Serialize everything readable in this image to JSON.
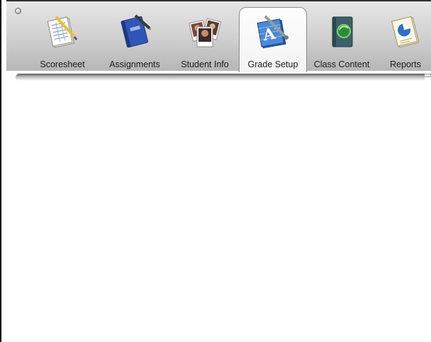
{
  "toolbar": {
    "tabs": [
      {
        "label": "Scoresheet",
        "icon": "scoresheet-icon",
        "selected": false
      },
      {
        "label": "Assignments",
        "icon": "assignments-notebook-icon",
        "selected": false
      },
      {
        "label": "Student Info",
        "icon": "student-photos-icon",
        "selected": false
      },
      {
        "label": "Grade Setup",
        "icon": "grade-setup-icon",
        "selected": true
      },
      {
        "label": "Class Content",
        "icon": "class-content-icon",
        "selected": false
      },
      {
        "label": "Reports",
        "icon": "reports-pie-icon",
        "selected": false
      }
    ]
  },
  "colors": {
    "toolbar_top": "#e6e6e6",
    "toolbar_bottom": "#b6b6b6",
    "selected_tab": "#f8f8f8",
    "accent_blue": "#5a86c6"
  }
}
